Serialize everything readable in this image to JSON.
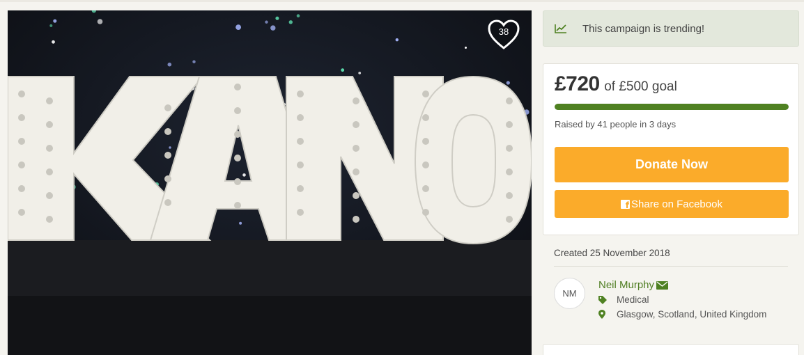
{
  "hero": {
    "image_text": "KANO",
    "favourite_count": "38"
  },
  "trending": {
    "icon": "trend-chart-icon",
    "label": "This campaign is trending!"
  },
  "donation": {
    "raised": "£720",
    "goal_text": "of £500 goal",
    "progress_fraction": 1.0,
    "stats": "Raised by 41 people in 3 days",
    "donate_label": "Donate Now",
    "share_label": "Share on Facebook"
  },
  "campaign": {
    "created": "Created 25 November 2018"
  },
  "organiser": {
    "initials": "NM",
    "name": "Neil Murphy",
    "category": "Medical",
    "location": "Glasgow, Scotland, United Kingdom"
  },
  "colors": {
    "accent_green": "#4f8122",
    "button_orange": "#fbab2a",
    "trending_bg": "#e3e8dc"
  }
}
